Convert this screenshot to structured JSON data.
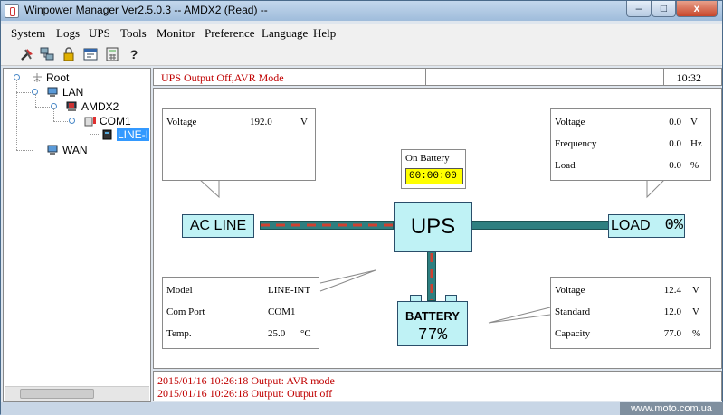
{
  "window": {
    "title": "Winpower Manager Ver2.5.0.3 -- AMDX2 (Read) --",
    "controls": {
      "minimize": "–",
      "maximize": "□",
      "close": "x"
    }
  },
  "menu": [
    "System",
    "Logs",
    "UPS",
    "Tools",
    "Monitor",
    "Preference",
    "Language",
    "Help"
  ],
  "toolbar": {
    "icons": [
      "tools-icon",
      "network-icon",
      "lock-icon",
      "schedule-icon",
      "calculator-icon",
      "help-icon"
    ],
    "help_glyph": "?"
  },
  "tree": {
    "root": "Root",
    "lan": "LAN",
    "host": "AMDX2",
    "port": "COM1",
    "device": "LINE-I",
    "wan": "WAN"
  },
  "status": {
    "message": "UPS Output Off,AVR Mode",
    "time": "10:32"
  },
  "input_panel": {
    "voltage_label": "Voltage",
    "voltage_value": "192.0",
    "voltage_unit": "V"
  },
  "output_panel": {
    "voltage_label": "Voltage",
    "voltage_value": "0.0",
    "voltage_unit": "V",
    "frequency_label": "Frequency",
    "frequency_value": "0.0",
    "frequency_unit": "Hz",
    "load_label": "Load",
    "load_value": "0.0",
    "load_unit": "%"
  },
  "info_panel": {
    "model_label": "Model",
    "model_value": "LINE-INT",
    "port_label": "Com Port",
    "port_value": "COM1",
    "temp_label": "Temp.",
    "temp_value": "25.0",
    "temp_unit": "°C"
  },
  "battery_panel": {
    "voltage_label": "Voltage",
    "voltage_value": "12.4",
    "voltage_unit": "V",
    "standard_label": "Standard",
    "standard_value": "12.0",
    "standard_unit": "V",
    "capacity_label": "Capacity",
    "capacity_value": "77.0",
    "capacity_unit": "%"
  },
  "on_battery": {
    "label": "On Battery",
    "timer": "00:00:00"
  },
  "diagram": {
    "ac_line": "AC LINE",
    "ups": "UPS",
    "load": "LOAD",
    "load_percent": "0%",
    "battery": "BATTERY",
    "battery_percent": "77%",
    "colors": {
      "box_fill": "#bff2f5",
      "pipe": "#2e7f80",
      "flow": "#d04030"
    }
  },
  "log": [
    "2015/01/16 10:26:18  Output: AVR mode",
    "2015/01/16 10:26:18  Output: Output off"
  ],
  "watermark": "www.moto.com.ua"
}
